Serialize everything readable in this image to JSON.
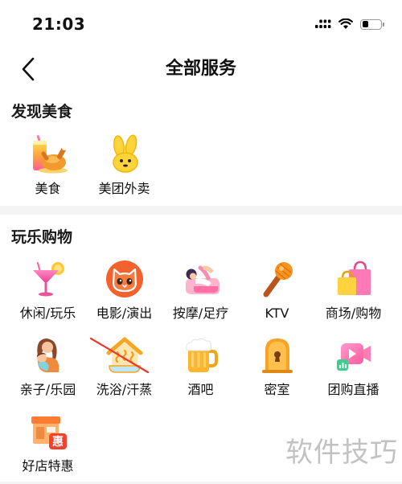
{
  "status_bar": {
    "time": "21:03",
    "icons": [
      "signal-icon",
      "wifi-icon",
      "battery-icon"
    ],
    "battery_level": 0.35
  },
  "nav": {
    "back_icon": "chevron-left-icon",
    "title": "全部服务"
  },
  "sections": [
    {
      "title": "发现美食",
      "items": [
        {
          "label": "美食",
          "icon": "food-icon"
        },
        {
          "label": "美团外卖",
          "icon": "meituan-waimai-icon"
        }
      ]
    },
    {
      "title": "玩乐购物",
      "items": [
        {
          "label": "休闲/玩乐",
          "icon": "cocktail-icon"
        },
        {
          "label": "电影/演出",
          "icon": "cat-face-icon"
        },
        {
          "label": "按摩/足疗",
          "icon": "massage-icon"
        },
        {
          "label": "KTV",
          "icon": "microphone-icon"
        },
        {
          "label": "商场/购物",
          "icon": "shopping-bags-icon"
        },
        {
          "label": "亲子/乐园",
          "icon": "mother-child-icon"
        },
        {
          "label": "洗浴/汗蒸",
          "icon": "bathhouse-icon"
        },
        {
          "label": "酒吧",
          "icon": "beer-mug-icon"
        },
        {
          "label": "密室",
          "icon": "locked-door-icon"
        },
        {
          "label": "团购直播",
          "icon": "video-camera-icon"
        },
        {
          "label": "好店特惠",
          "icon": "shop-discount-icon",
          "badge": "惠"
        }
      ]
    }
  ],
  "watermark": "软件技巧",
  "colors": {
    "background": "#ffffff",
    "text": "#111111",
    "divider": "#f4f4f4",
    "watermark": "#c2c2c2",
    "annotation": "#e8382f"
  }
}
